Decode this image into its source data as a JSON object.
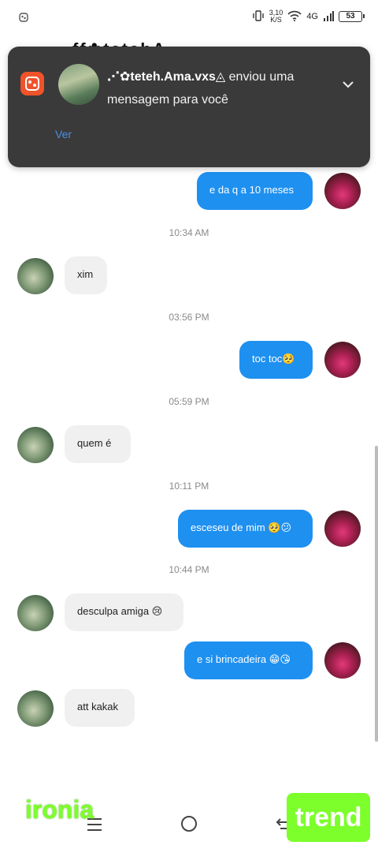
{
  "status_bar": {
    "left_icon": "notification-app-icon",
    "speed": "3,10",
    "speed_unit": "K/S",
    "network": "4G",
    "battery": "53"
  },
  "header": {
    "name": "ff✿tetehA"
  },
  "notification": {
    "sender": "⋰✿teteh.Ama.vxs◬",
    "message_line1": " enviou uma",
    "message_line2": "mensagem para você",
    "action": "Ver"
  },
  "messages": [
    {
      "side": "out",
      "text": "e da q a 10 meses"
    },
    {
      "time": "10:34 AM"
    },
    {
      "side": "in",
      "text": "xim"
    },
    {
      "time": "03:56 PM"
    },
    {
      "side": "out",
      "text": "toc toc🥺"
    },
    {
      "time": "05:59 PM"
    },
    {
      "side": "in",
      "text": "quem é"
    },
    {
      "time": "10:11 PM"
    },
    {
      "side": "out",
      "text": "esceseu de mim 🥺😕"
    },
    {
      "time": "10:44 PM"
    },
    {
      "side": "in",
      "text": "desculpa amiga 😢"
    },
    {
      "side": "out",
      "text": "e si brincadeira 😁😘"
    },
    {
      "side": "in",
      "text": "att kakak"
    }
  ],
  "watermarks": {
    "left": "ironia",
    "right": "trend"
  },
  "colors": {
    "outgoing_bubble": "#1e90f0",
    "incoming_bubble": "#f0f0f0",
    "notification_bg": "#3a3a3a",
    "watermark_green": "#7cff2a"
  }
}
